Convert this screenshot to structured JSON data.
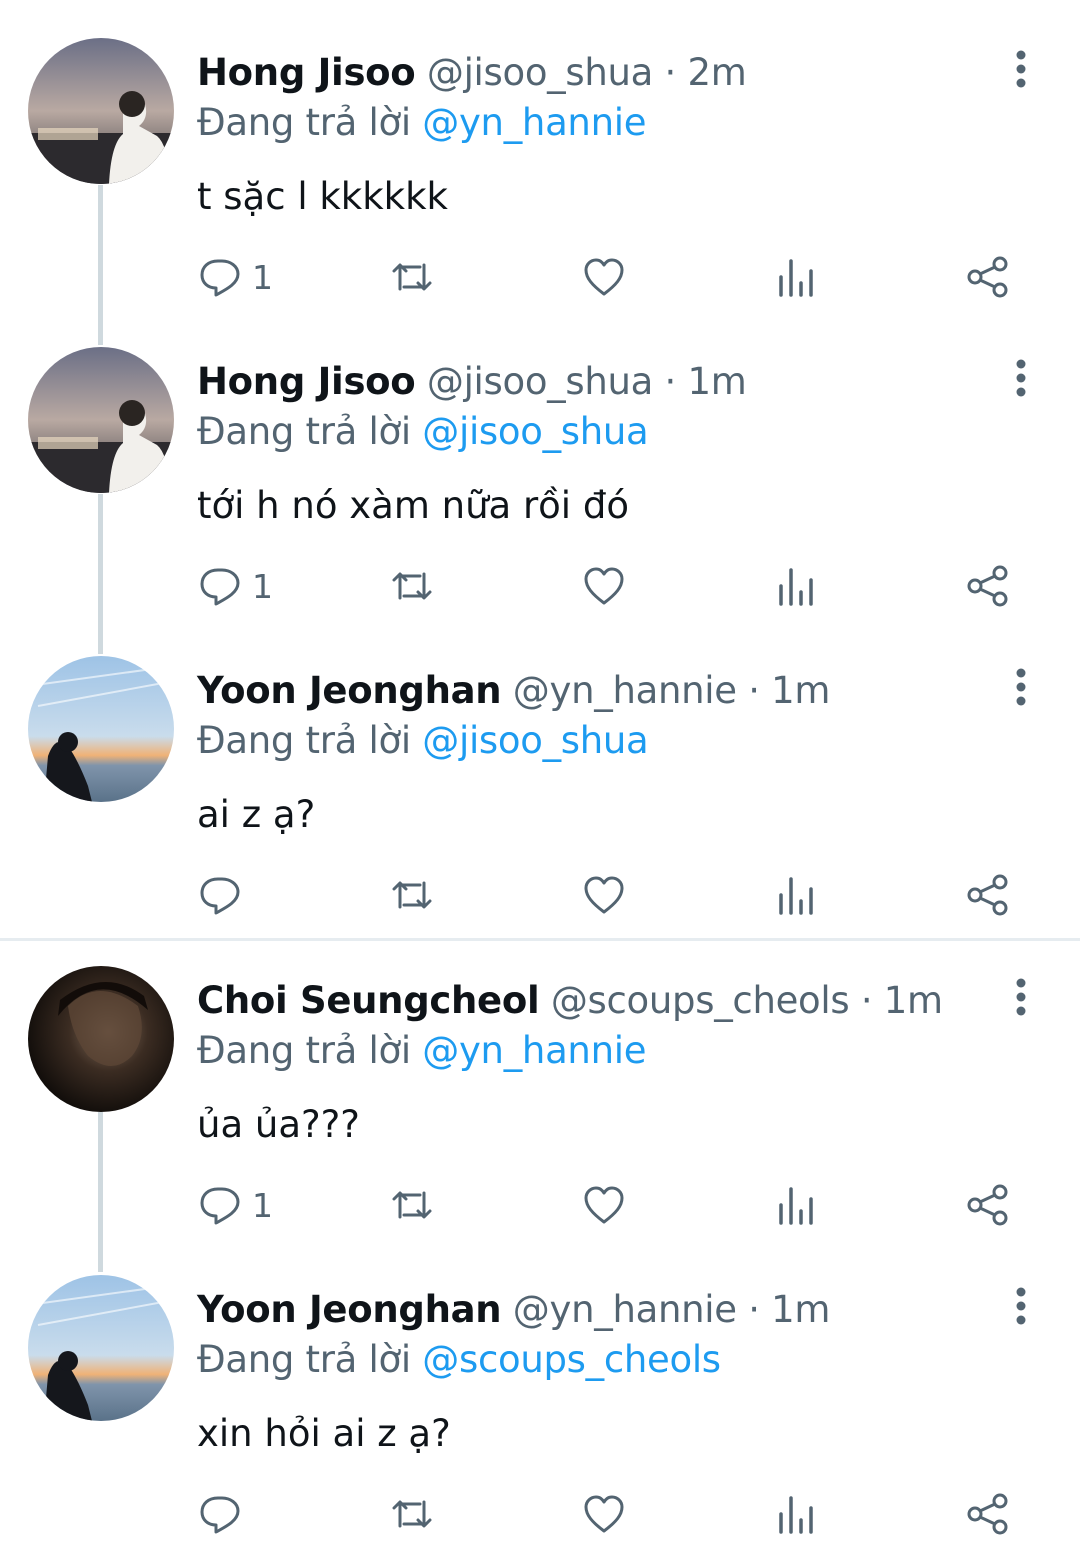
{
  "colors": {
    "text": "#0f1419",
    "muted": "#536471",
    "link": "#1d9bf0",
    "thread_line": "#cfd9de",
    "divider": "#e6ecf0"
  },
  "icons": {
    "reply": "comment-icon",
    "retweet": "retweet-icon",
    "like": "heart-icon",
    "views": "analytics-icon",
    "share": "share-icon",
    "more": "more-vertical-icon"
  },
  "tweets": [
    {
      "name": "Hong Jisoo",
      "handle": "@jisoo_shua",
      "dot": "·",
      "time": "2m",
      "replying_prefix": "Đang trả lời",
      "replying_to": "@yn_hannie",
      "text": "t sặc l kkkkkk",
      "reply_count": "1"
    },
    {
      "name": "Hong Jisoo",
      "handle": "@jisoo_shua",
      "dot": "·",
      "time": "1m",
      "replying_prefix": "Đang trả lời",
      "replying_to": "@jisoo_shua",
      "text": "tới h nó xàm nữa rồi đó",
      "reply_count": "1"
    },
    {
      "name": "Yoon Jeonghan",
      "handle": "@yn_hannie",
      "dot": "·",
      "time": "1m",
      "replying_prefix": "Đang trả lời",
      "replying_to": "@jisoo_shua",
      "text": "ai z ạ?",
      "reply_count": ""
    },
    {
      "name": "Choi Seungcheol",
      "handle": "@scoups_cheols",
      "dot": "·",
      "time": "1m",
      "replying_prefix": "Đang trả lời",
      "replying_to": "@yn_hannie",
      "text": "ủa ủa???",
      "reply_count": "1"
    },
    {
      "name": "Yoon Jeonghan",
      "handle": "@yn_hannie",
      "dot": "·",
      "time": "1m",
      "replying_prefix": "Đang trả lời",
      "replying_to": "@scoups_cheols",
      "text": "xin hỏi ai z ạ?",
      "reply_count": ""
    }
  ]
}
